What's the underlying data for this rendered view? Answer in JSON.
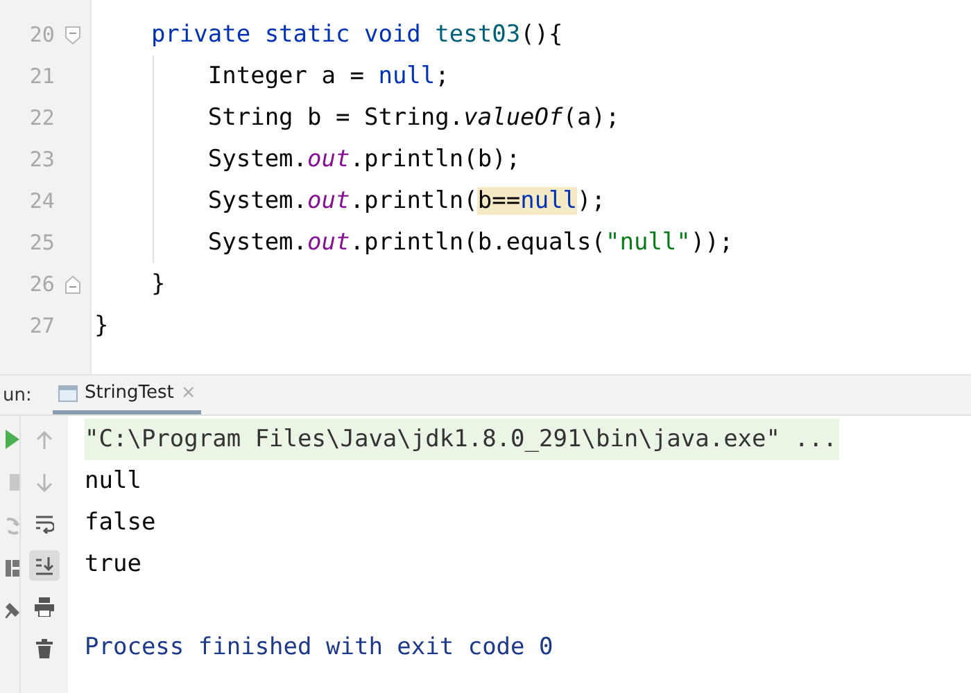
{
  "editor": {
    "lines": [
      {
        "number": "20",
        "kind": "fold-start",
        "tokens": [
          {
            "text": "    private static void ",
            "kind": "keyword"
          },
          {
            "text": "test03",
            "kind": "declaration"
          },
          {
            "text": "(){",
            "kind": "plain"
          }
        ]
      },
      {
        "number": "21",
        "kind": "code",
        "tokens": [
          {
            "text": "        Integer a = ",
            "kind": "plain"
          },
          {
            "text": "null",
            "kind": "keyword"
          },
          {
            "text": ";",
            "kind": "plain"
          }
        ]
      },
      {
        "number": "22",
        "kind": "code",
        "tokens": [
          {
            "text": "        String b = String.",
            "kind": "plain"
          },
          {
            "text": "valueOf",
            "kind": "static-call"
          },
          {
            "text": "(a);",
            "kind": "plain"
          }
        ]
      },
      {
        "number": "23",
        "kind": "code",
        "tokens": [
          {
            "text": "        System.",
            "kind": "plain"
          },
          {
            "text": "out",
            "kind": "field"
          },
          {
            "text": ".println(b);",
            "kind": "plain"
          }
        ]
      },
      {
        "number": "24",
        "kind": "code",
        "tokens": [
          {
            "text": "        System.",
            "kind": "plain"
          },
          {
            "text": "out",
            "kind": "field"
          },
          {
            "text": ".println(",
            "kind": "plain"
          },
          {
            "text": "b==",
            "kind": "match-plain"
          },
          {
            "text": "null",
            "kind": "match-keyword"
          },
          {
            "text": ");",
            "kind": "plain"
          }
        ]
      },
      {
        "number": "25",
        "kind": "code",
        "tokens": [
          {
            "text": "        System.",
            "kind": "plain"
          },
          {
            "text": "out",
            "kind": "field"
          },
          {
            "text": ".println(b.equals(",
            "kind": "plain"
          },
          {
            "text": "\"null\"",
            "kind": "string"
          },
          {
            "text": "));",
            "kind": "plain"
          }
        ]
      },
      {
        "number": "26",
        "kind": "fold-end",
        "tokens": [
          {
            "text": "    }",
            "kind": "plain"
          }
        ]
      },
      {
        "number": "27",
        "kind": "code",
        "tokens": [
          {
            "text": "}",
            "kind": "plain"
          }
        ]
      }
    ]
  },
  "run_panel": {
    "label": "un:",
    "tabs": [
      {
        "title": "StringTest",
        "close": "×",
        "selected": true
      }
    ],
    "output": [
      {
        "text": "\"C:\\Program Files\\Java\\jdk1.8.0_291\\bin\\java.exe\" ...",
        "kind": "command"
      },
      {
        "text": "null",
        "kind": "stdout"
      },
      {
        "text": "false",
        "kind": "stdout"
      },
      {
        "text": "true",
        "kind": "stdout"
      },
      {
        "kind": "blank"
      },
      {
        "text": "Process finished with exit code 0",
        "kind": "exit"
      }
    ],
    "side_tools": [
      {
        "kind": "up",
        "selected": false
      },
      {
        "kind": "down",
        "selected": false
      },
      {
        "kind": "wrap",
        "selected": false
      },
      {
        "kind": "scroll-end",
        "selected": true
      },
      {
        "kind": "print",
        "selected": false
      },
      {
        "kind": "trash",
        "selected": false
      }
    ]
  }
}
